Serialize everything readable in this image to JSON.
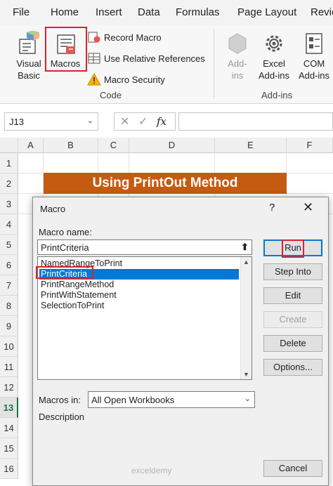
{
  "ribbon": {
    "tabs": [
      "File",
      "Home",
      "Insert",
      "Data",
      "Formulas",
      "Page Layout",
      "Revie"
    ],
    "code_group": {
      "visual_basic": [
        "Visual",
        "Basic"
      ],
      "macros": "Macros",
      "record_macro": "Record Macro",
      "relative_refs": "Use Relative References",
      "macro_security": "Macro Security",
      "label": "Code"
    },
    "addins_group": {
      "addins": [
        "Add-",
        "ins"
      ],
      "excel_addins": [
        "Excel",
        "Add-ins"
      ],
      "com_addins": [
        "COM",
        "Add-ins"
      ],
      "label": "Add-ins"
    }
  },
  "formula_bar": {
    "name_box": "J13",
    "fx": "fx"
  },
  "grid": {
    "columns": [
      "A",
      "B",
      "C",
      "D",
      "E",
      "F"
    ],
    "rows": [
      "1",
      "2",
      "3",
      "4",
      "5",
      "6",
      "7",
      "8",
      "9",
      "10",
      "11",
      "12",
      "13",
      "14",
      "15",
      "16"
    ],
    "selected_row": "13",
    "banner": "Using PrintOut Method"
  },
  "dialog": {
    "title": "Macro",
    "help": "?",
    "close": "✕",
    "macro_name_label": "Macro name:",
    "macro_name_value": "PrintCriteria",
    "macros": [
      "NamedRangeToPrint",
      "PrintCriteria",
      "PrintRangeMethod",
      "PrintWithStatement",
      "SelectionToPrint"
    ],
    "selected_macro": "PrintCriteria",
    "buttons": {
      "run": "Run",
      "step_into": "Step Into",
      "edit": "Edit",
      "create": "Create",
      "delete": "Delete",
      "options": "Options...",
      "cancel": "Cancel"
    },
    "macros_in_label": "Macros in:",
    "macros_in_value": "All Open Workbooks",
    "description_label": "Description"
  },
  "watermark": "exceldemy"
}
